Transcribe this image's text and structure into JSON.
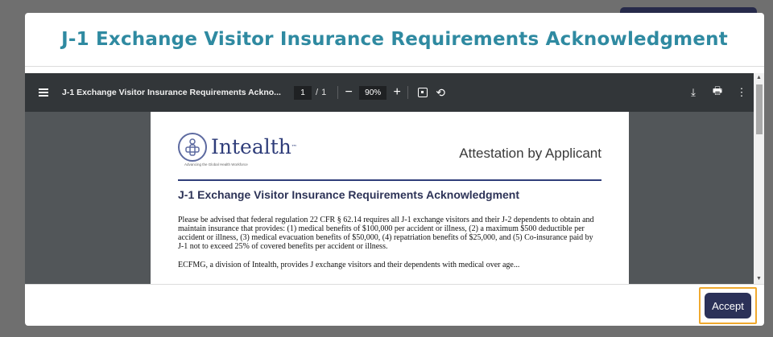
{
  "modal": {
    "title": "J-1 Exchange Visitor Insurance Requirements Acknowledgment",
    "accept_label": "Accept"
  },
  "viewer": {
    "doc_title": "J-1 Exchange Visitor Insurance Requirements Ackno...",
    "page_current": "1",
    "page_separator": "/",
    "page_total": "1",
    "zoom": "90%",
    "zoom_out_label": "−",
    "zoom_in_label": "+",
    "download_icon": "⤓",
    "print_icon": "🖶",
    "more_icon": "⋮",
    "rotate_icon": "⟲"
  },
  "pdf": {
    "logo_name": "Intealth",
    "logo_tm": "™",
    "logo_tagline": "Advancing the Global Health Workforce",
    "attestation": "Attestation by Applicant",
    "heading": "J-1 Exchange Visitor Insurance Requirements Acknowledgment",
    "paragraph": "Please be advised that federal regulation 22 CFR § 62.14 requires all J-1 exchange visitors and their J-2 dependents to obtain and maintain insurance that provides: (1) medical benefits of $100,000 per accident or illness, (2) a maximum $500 deductible per accident or illness, (3) medical evacuation benefits of $50,000, (4) repatriation benefits of $25,000, and (5) Co-insurance paid by J-1 not to exceed 25% of covered benefits per accident or illness.",
    "paragraph2": "ECFMG, a division of Intealth, provides J exchange visitors and their dependents with medical over age..."
  },
  "colors": {
    "title": "#2f8aa1",
    "accept_bg": "#2b3158",
    "highlight": "#f0a92e",
    "toolbar": "#323639"
  }
}
